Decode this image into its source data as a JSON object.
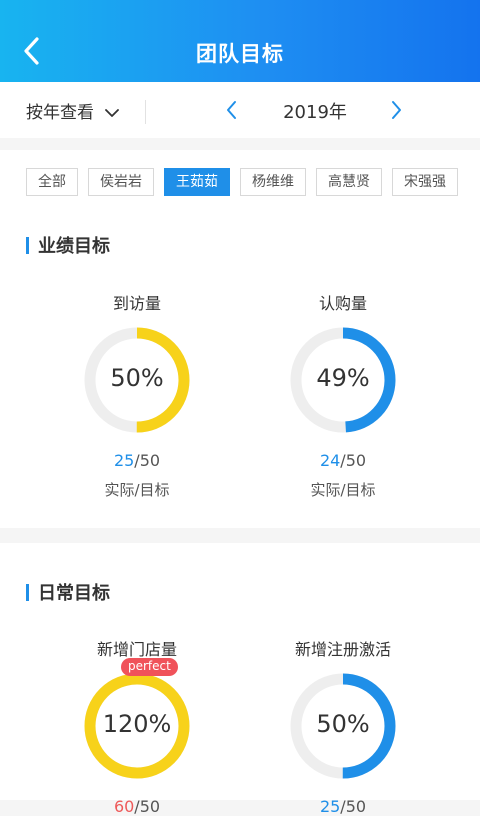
{
  "header": {
    "title": "团队目标"
  },
  "filter": {
    "mode_label": "按年查看",
    "year": "2019年"
  },
  "members": [
    "全部",
    "侯岩岩",
    "王茹茹",
    "杨维维",
    "高慧贤",
    "宋强强"
  ],
  "active_member": "王茹茹",
  "performance": {
    "title": "业绩目标",
    "items": [
      {
        "label": "到访量",
        "percent_text": "50%",
        "percent": 50,
        "actual": "25",
        "target": "/50",
        "caption": "实际/目标",
        "color": "#f7d21a"
      },
      {
        "label": "认购量",
        "percent_text": "49%",
        "percent": 49,
        "actual": "24",
        "target": "/50",
        "caption": "实际/目标",
        "color": "#1f8fe8"
      }
    ]
  },
  "daily": {
    "title": "日常目标",
    "items": [
      {
        "label": "新增门店量",
        "percent_text": "120%",
        "percent": 120,
        "badge": "perfect",
        "actual": "60",
        "target": "/50",
        "color": "#f7d21a"
      },
      {
        "label": "新增注册激活",
        "percent_text": "50%",
        "percent": 50,
        "actual": "25",
        "target": "/50",
        "color": "#1f8fe8"
      }
    ]
  },
  "colors": {
    "accent": "#1f8fe8",
    "ring_track": "#eeeeee",
    "badge": "#f0525a"
  }
}
